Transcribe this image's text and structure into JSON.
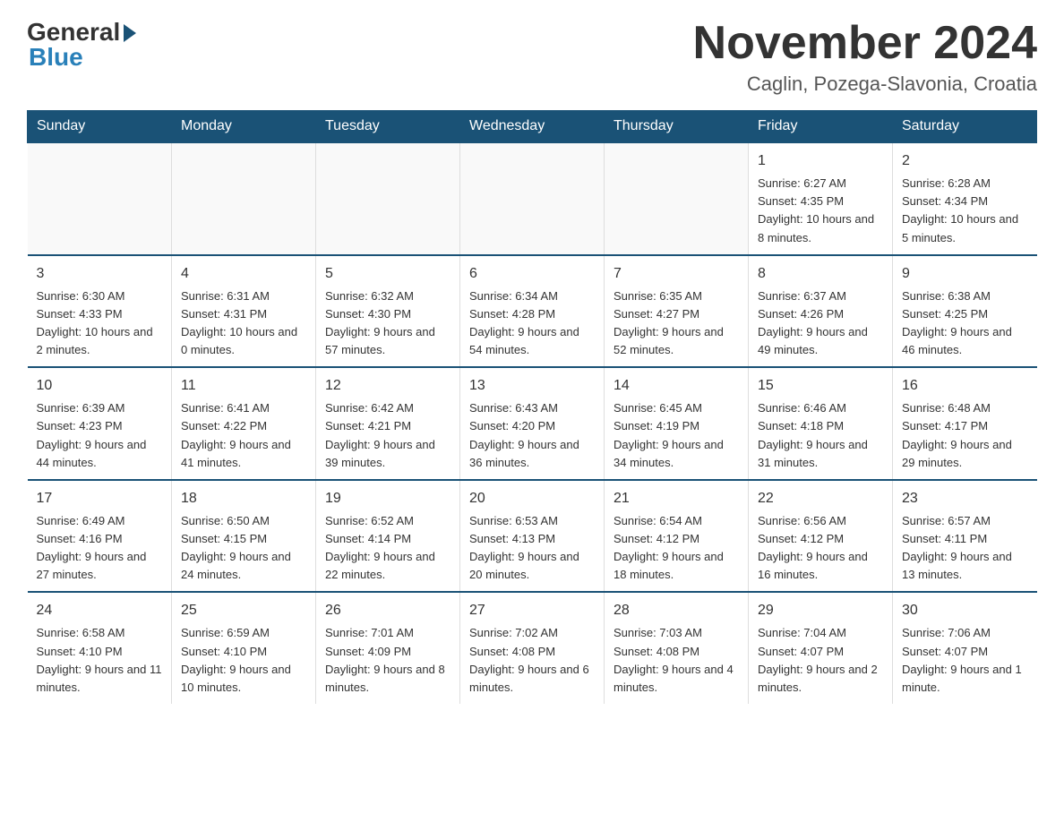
{
  "header": {
    "logo_general": "General",
    "logo_blue": "Blue",
    "month_title": "November 2024",
    "location": "Caglin, Pozega-Slavonia, Croatia"
  },
  "weekdays": [
    "Sunday",
    "Monday",
    "Tuesday",
    "Wednesday",
    "Thursday",
    "Friday",
    "Saturday"
  ],
  "weeks": [
    [
      {
        "day": "",
        "info": ""
      },
      {
        "day": "",
        "info": ""
      },
      {
        "day": "",
        "info": ""
      },
      {
        "day": "",
        "info": ""
      },
      {
        "day": "",
        "info": ""
      },
      {
        "day": "1",
        "info": "Sunrise: 6:27 AM\nSunset: 4:35 PM\nDaylight: 10 hours and 8 minutes."
      },
      {
        "day": "2",
        "info": "Sunrise: 6:28 AM\nSunset: 4:34 PM\nDaylight: 10 hours and 5 minutes."
      }
    ],
    [
      {
        "day": "3",
        "info": "Sunrise: 6:30 AM\nSunset: 4:33 PM\nDaylight: 10 hours and 2 minutes."
      },
      {
        "day": "4",
        "info": "Sunrise: 6:31 AM\nSunset: 4:31 PM\nDaylight: 10 hours and 0 minutes."
      },
      {
        "day": "5",
        "info": "Sunrise: 6:32 AM\nSunset: 4:30 PM\nDaylight: 9 hours and 57 minutes."
      },
      {
        "day": "6",
        "info": "Sunrise: 6:34 AM\nSunset: 4:28 PM\nDaylight: 9 hours and 54 minutes."
      },
      {
        "day": "7",
        "info": "Sunrise: 6:35 AM\nSunset: 4:27 PM\nDaylight: 9 hours and 52 minutes."
      },
      {
        "day": "8",
        "info": "Sunrise: 6:37 AM\nSunset: 4:26 PM\nDaylight: 9 hours and 49 minutes."
      },
      {
        "day": "9",
        "info": "Sunrise: 6:38 AM\nSunset: 4:25 PM\nDaylight: 9 hours and 46 minutes."
      }
    ],
    [
      {
        "day": "10",
        "info": "Sunrise: 6:39 AM\nSunset: 4:23 PM\nDaylight: 9 hours and 44 minutes."
      },
      {
        "day": "11",
        "info": "Sunrise: 6:41 AM\nSunset: 4:22 PM\nDaylight: 9 hours and 41 minutes."
      },
      {
        "day": "12",
        "info": "Sunrise: 6:42 AM\nSunset: 4:21 PM\nDaylight: 9 hours and 39 minutes."
      },
      {
        "day": "13",
        "info": "Sunrise: 6:43 AM\nSunset: 4:20 PM\nDaylight: 9 hours and 36 minutes."
      },
      {
        "day": "14",
        "info": "Sunrise: 6:45 AM\nSunset: 4:19 PM\nDaylight: 9 hours and 34 minutes."
      },
      {
        "day": "15",
        "info": "Sunrise: 6:46 AM\nSunset: 4:18 PM\nDaylight: 9 hours and 31 minutes."
      },
      {
        "day": "16",
        "info": "Sunrise: 6:48 AM\nSunset: 4:17 PM\nDaylight: 9 hours and 29 minutes."
      }
    ],
    [
      {
        "day": "17",
        "info": "Sunrise: 6:49 AM\nSunset: 4:16 PM\nDaylight: 9 hours and 27 minutes."
      },
      {
        "day": "18",
        "info": "Sunrise: 6:50 AM\nSunset: 4:15 PM\nDaylight: 9 hours and 24 minutes."
      },
      {
        "day": "19",
        "info": "Sunrise: 6:52 AM\nSunset: 4:14 PM\nDaylight: 9 hours and 22 minutes."
      },
      {
        "day": "20",
        "info": "Sunrise: 6:53 AM\nSunset: 4:13 PM\nDaylight: 9 hours and 20 minutes."
      },
      {
        "day": "21",
        "info": "Sunrise: 6:54 AM\nSunset: 4:12 PM\nDaylight: 9 hours and 18 minutes."
      },
      {
        "day": "22",
        "info": "Sunrise: 6:56 AM\nSunset: 4:12 PM\nDaylight: 9 hours and 16 minutes."
      },
      {
        "day": "23",
        "info": "Sunrise: 6:57 AM\nSunset: 4:11 PM\nDaylight: 9 hours and 13 minutes."
      }
    ],
    [
      {
        "day": "24",
        "info": "Sunrise: 6:58 AM\nSunset: 4:10 PM\nDaylight: 9 hours and 11 minutes."
      },
      {
        "day": "25",
        "info": "Sunrise: 6:59 AM\nSunset: 4:10 PM\nDaylight: 9 hours and 10 minutes."
      },
      {
        "day": "26",
        "info": "Sunrise: 7:01 AM\nSunset: 4:09 PM\nDaylight: 9 hours and 8 minutes."
      },
      {
        "day": "27",
        "info": "Sunrise: 7:02 AM\nSunset: 4:08 PM\nDaylight: 9 hours and 6 minutes."
      },
      {
        "day": "28",
        "info": "Sunrise: 7:03 AM\nSunset: 4:08 PM\nDaylight: 9 hours and 4 minutes."
      },
      {
        "day": "29",
        "info": "Sunrise: 7:04 AM\nSunset: 4:07 PM\nDaylight: 9 hours and 2 minutes."
      },
      {
        "day": "30",
        "info": "Sunrise: 7:06 AM\nSunset: 4:07 PM\nDaylight: 9 hours and 1 minute."
      }
    ]
  ]
}
